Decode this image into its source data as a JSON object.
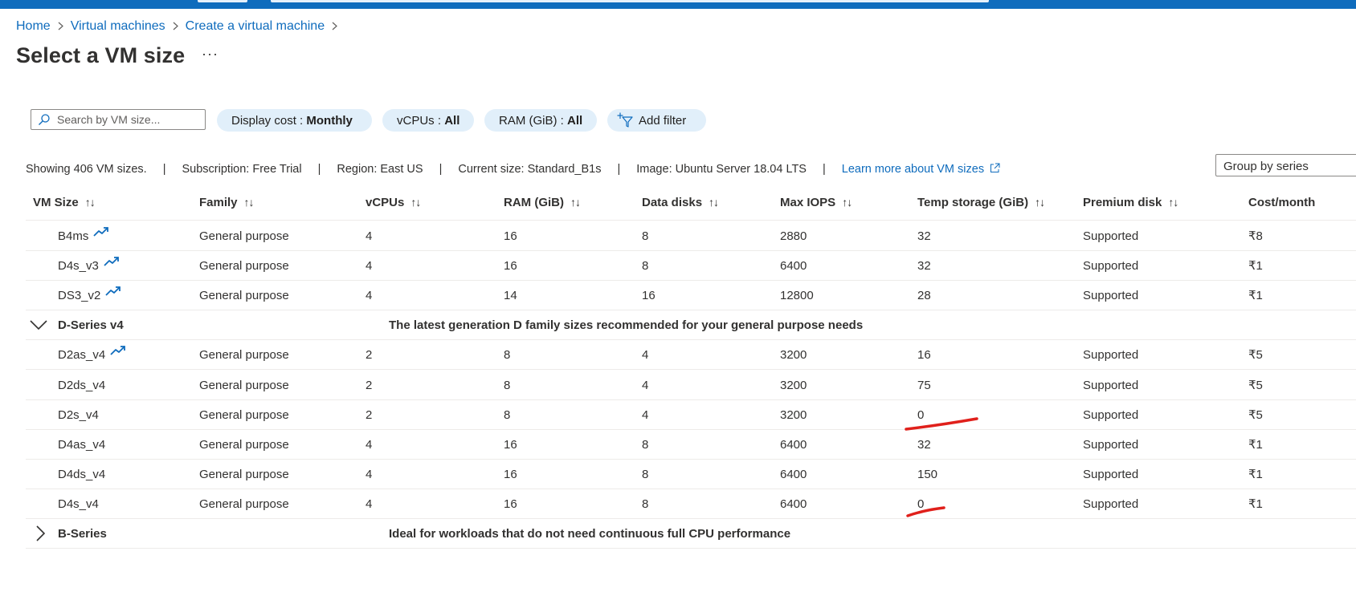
{
  "breadcrumb": {
    "home": "Home",
    "vms": "Virtual machines",
    "create": "Create a virtual machine"
  },
  "page_title": "Select a VM size",
  "more_label": "···",
  "search": {
    "placeholder": "Search by VM size..."
  },
  "filters": {
    "cost_label": "Display cost : ",
    "cost_value": "Monthly",
    "vcpus_label": "vCPUs : ",
    "vcpus_value": "All",
    "ram_label": "RAM (GiB) : ",
    "ram_value": "All",
    "add_filter": "Add filter"
  },
  "summary": {
    "showing": "Showing 406 VM sizes.",
    "subscription": "Subscription: Free Trial",
    "region": "Region: East US",
    "current": "Current size: Standard_B1s",
    "image": "Image: Ubuntu Server 18.04 LTS",
    "learn_more": "Learn more about VM sizes",
    "separator": "|",
    "group_btn": "Group by series"
  },
  "columns": [
    "VM Size",
    "Family",
    "vCPUs",
    "RAM (GiB)",
    "Data disks",
    "Max IOPS",
    "Temp storage (GiB)",
    "Premium disk",
    "Cost/month"
  ],
  "sort_glyph": "↑↓",
  "rows": [
    {
      "kind": "size",
      "name": "B4ms",
      "trend": true,
      "family": "General purpose",
      "vcpus": "4",
      "ram": "16",
      "disks": "8",
      "iops": "2880",
      "temp": "32",
      "premium": "Supported",
      "cost": "₹8"
    },
    {
      "kind": "size",
      "name": "D4s_v3",
      "trend": true,
      "family": "General purpose",
      "vcpus": "4",
      "ram": "16",
      "disks": "8",
      "iops": "6400",
      "temp": "32",
      "premium": "Supported",
      "cost": "₹1"
    },
    {
      "kind": "size",
      "name": "DS3_v2",
      "trend": true,
      "family": "General purpose",
      "vcpus": "4",
      "ram": "14",
      "disks": "16",
      "iops": "12800",
      "temp": "28",
      "premium": "Supported",
      "cost": "₹1"
    },
    {
      "kind": "group",
      "expanded": true,
      "name": "D-Series v4",
      "desc": "The latest generation D family sizes recommended for your general purpose needs"
    },
    {
      "kind": "size",
      "name": "D2as_v4",
      "trend": true,
      "family": "General purpose",
      "vcpus": "2",
      "ram": "8",
      "disks": "4",
      "iops": "3200",
      "temp": "16",
      "premium": "Supported",
      "cost": "₹5"
    },
    {
      "kind": "size",
      "name": "D2ds_v4",
      "trend": false,
      "family": "General purpose",
      "vcpus": "2",
      "ram": "8",
      "disks": "4",
      "iops": "3200",
      "temp": "75",
      "premium": "Supported",
      "cost": "₹5"
    },
    {
      "kind": "size",
      "name": "D2s_v4",
      "trend": false,
      "family": "General purpose",
      "vcpus": "2",
      "ram": "8",
      "disks": "4",
      "iops": "3200",
      "temp": "0",
      "premium": "Supported",
      "cost": "₹5"
    },
    {
      "kind": "size",
      "name": "D4as_v4",
      "trend": false,
      "family": "General purpose",
      "vcpus": "4",
      "ram": "16",
      "disks": "8",
      "iops": "6400",
      "temp": "32",
      "premium": "Supported",
      "cost": "₹1"
    },
    {
      "kind": "size",
      "name": "D4ds_v4",
      "trend": false,
      "family": "General purpose",
      "vcpus": "4",
      "ram": "16",
      "disks": "8",
      "iops": "6400",
      "temp": "150",
      "premium": "Supported",
      "cost": "₹1"
    },
    {
      "kind": "size",
      "name": "D4s_v4",
      "trend": false,
      "family": "General purpose",
      "vcpus": "4",
      "ram": "16",
      "disks": "8",
      "iops": "6400",
      "temp": "0",
      "premium": "Supported",
      "cost": "₹1"
    },
    {
      "kind": "group",
      "expanded": false,
      "name": "B-Series",
      "desc": "Ideal for workloads that do not need continuous full CPU performance"
    }
  ],
  "colors": {
    "accent": "#0f6cbd",
    "pill_bg": "#e1effa",
    "annotation": "#e0201b"
  },
  "icons": {
    "trend": "trend-up-icon",
    "external": "external-link-icon",
    "filter": "filter-add-icon",
    "search": "search-icon"
  }
}
